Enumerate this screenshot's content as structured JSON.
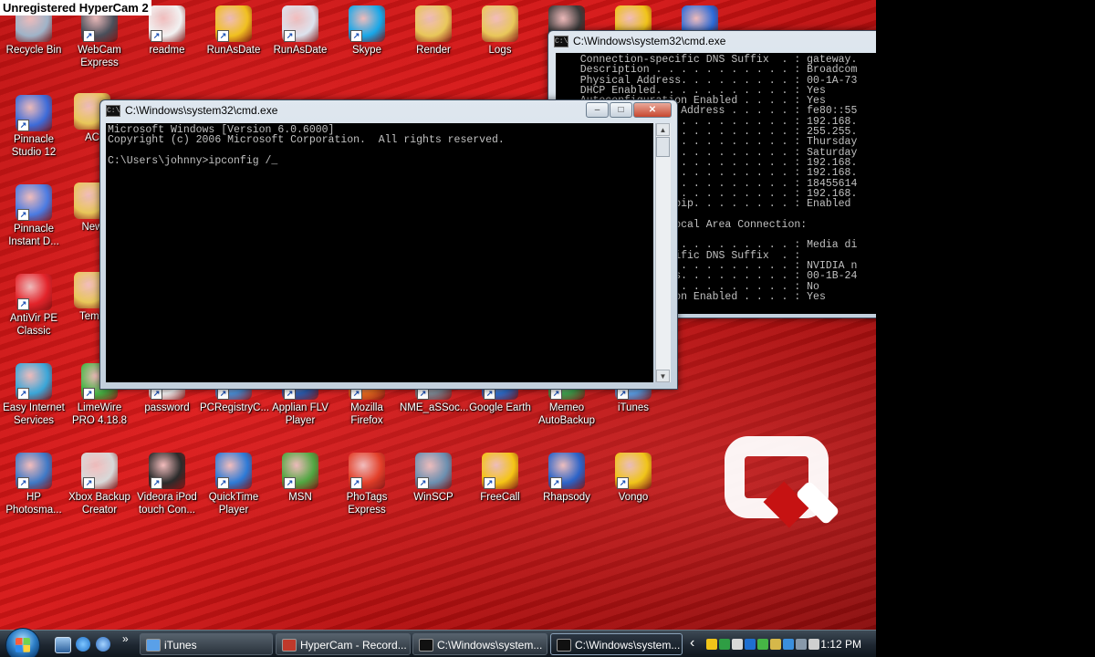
{
  "watermark": "Unregistered HyperCam 2",
  "desktop": {
    "icons_top": [
      {
        "label": "Recycle Bin",
        "color": "#9fb3c8"
      },
      {
        "label": "WebCam Express",
        "color": "#4a4f5a"
      },
      {
        "label": "readme",
        "color": "#f2f2f2"
      },
      {
        "label": "RunAsDate",
        "color": "#f0c020"
      },
      {
        "label": "RunAsDate",
        "color": "#dde3ee"
      },
      {
        "label": "Skype",
        "color": "#17a7e8"
      },
      {
        "label": "Render",
        "color": "#e9c75a"
      },
      {
        "label": "Logs",
        "color": "#e9c75a"
      }
    ],
    "icons_left": [
      {
        "label": "Pinnacle Studio 12",
        "color": "#3d6bd8"
      },
      {
        "label": "Pinnacle Instant D...",
        "color": "#4b7be2"
      },
      {
        "label": "AntiVir PE Classic",
        "color": "#e3242b"
      },
      {
        "label": "Easy Internet Services",
        "color": "#3aa6d8"
      }
    ],
    "icons_left_partial": [
      {
        "label": "AC",
        "color": "#e9c75a"
      },
      {
        "label": "New",
        "color": "#e9c75a"
      },
      {
        "label": "Temp",
        "color": "#e9c75a"
      }
    ],
    "icons_mid_row": [
      {
        "label": "LimeWire PRO 4.18.8",
        "color": "#46b545"
      },
      {
        "label": "password",
        "color": "#f2f2f2"
      },
      {
        "label": "PCRegistryC...",
        "color": "#4a90d9"
      },
      {
        "label": "Applian FLV Player",
        "color": "#2a5fb4"
      },
      {
        "label": "Mozilla Firefox",
        "color": "#e66a1f"
      },
      {
        "label": "NME_aSSoc...",
        "color": "#7d8a96"
      },
      {
        "label": "Google Earth",
        "color": "#2c6fcf"
      },
      {
        "label": "Memeo AutoBackup",
        "color": "#3da34f"
      },
      {
        "label": "iTunes",
        "color": "#5aa0e8"
      }
    ],
    "icons_bottom_row": [
      {
        "label": "HP Photosma...",
        "color": "#3f79c6"
      },
      {
        "label": "Xbox Backup Creator",
        "color": "#d8d8d8"
      },
      {
        "label": "Videora iPod touch Con...",
        "color": "#2b2b2b"
      },
      {
        "label": "QuickTime Player",
        "color": "#2d7ad6"
      },
      {
        "label": "MSN",
        "color": "#51a641"
      },
      {
        "label": "PhoTags Express",
        "color": "#e3402a"
      },
      {
        "label": "WinSCP",
        "color": "#6b8fb0"
      },
      {
        "label": "FreeCall",
        "color": "#f5c416"
      },
      {
        "label": "Rhapsody",
        "color": "#2b63c8"
      },
      {
        "label": "Vongo",
        "color": "#f0c419"
      }
    ],
    "hidden_row_icons": [
      {
        "color": "#3a3a3a"
      },
      {
        "color": "#f0c419"
      },
      {
        "color": "#2a6ad8"
      }
    ]
  },
  "cmd_back": {
    "title": "C:\\Windows\\system32\\cmd.exe",
    "lines": [
      "   Connection-specific DNS Suffix  . : gateway.",
      "   Description . . . . . . . . . . . : Broadcom",
      "   Physical Address. . . . . . . . . : 00-1A-73",
      "   DHCP Enabled. . . . . . . . . . . : Yes",
      "   Autoconfiguration Enabled . . . . : Yes",
      "   Link-local IPv6 Address . . . . . : fe80::55",
      "   IPv4 Address. . . . . . . . . . . : 192.168.",
      "   Subnet Mask . . . . . . . . . . . : 255.255.",
      "   Lease Obtained. . . . . . . . . . : Thursday",
      "   Lease Expires . . . . . . . . . . : Saturday",
      "   Default Gateway . . . . . . . . . : 192.168.",
      "   DHCP Server . . . . . . . . . . . : 192.168.",
      "   DHCPv6 IAID . . . . . . . . . . . : 18455614",
      "   DNS Servers . . . . . . . . . . . : 192.168.",
      "   NetBIOS over Tcpip. . . . . . . . : Enabled",
      "",
      "Ethernet adapter Local Area Connection:",
      "",
      "   Media State . . . . . . . . . . . : Media di",
      "   Connection-specific DNS Suffix  . :",
      "   Description . . . . . . . . . . . : NVIDIA n",
      "   Physical Address. . . . . . . . . : 00-1B-24",
      "   DHCP Enabled. . . . . . . . . . . : No",
      "   Autoconfiguration Enabled . . . . : Yes"
    ]
  },
  "cmd_front": {
    "title": "C:\\Windows\\system32\\cmd.exe",
    "lines": [
      "Microsoft Windows [Version 6.0.6000]",
      "Copyright (c) 2006 Microsoft Corporation.  All rights reserved.",
      "",
      "C:\\Users\\johnny>ipconfig /_"
    ],
    "controls": {
      "minimize": "–",
      "maximize": "□",
      "close": "✕"
    }
  },
  "taskbar": {
    "quicklaunch_overflow": "»",
    "buttons": [
      {
        "label": "iTunes",
        "icon_color": "#5aa0e8"
      },
      {
        "label": "HyperCam - Record...",
        "icon_color": "#c0392b"
      },
      {
        "label": "C:\\Windows\\system...",
        "icon_color": "#111111"
      },
      {
        "label": "C:\\Windows\\system...",
        "icon_color": "#111111"
      }
    ],
    "tray_chevron": "‹",
    "tray_icons": [
      "#f0c419",
      "#2f9e44",
      "#d8d8d8",
      "#1f6fd0",
      "#46b545",
      "#d6b84a",
      "#3a8fdd",
      "#8899aa",
      "#cfcfcf"
    ],
    "clock": "1:12 PM"
  },
  "colors": {
    "desktop_red": "#c91212",
    "console_text": "#c0c0c0"
  }
}
